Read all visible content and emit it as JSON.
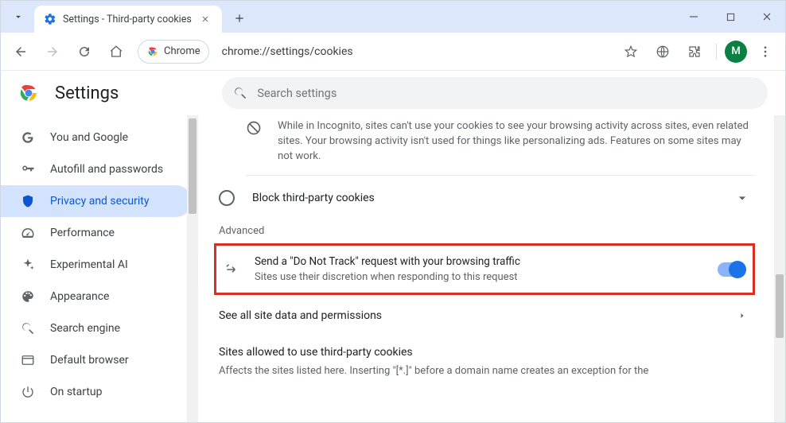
{
  "window": {
    "tab_title": "Settings - Third-party cookies",
    "omni_chip": "Chrome",
    "url": "chrome://settings/cookies",
    "avatar_letter": "M"
  },
  "app": {
    "title": "Settings",
    "search_placeholder": "Search settings"
  },
  "sidebar": {
    "items": [
      {
        "label": "You and Google"
      },
      {
        "label": "Autofill and passwords"
      },
      {
        "label": "Privacy and security"
      },
      {
        "label": "Performance"
      },
      {
        "label": "Experimental AI"
      },
      {
        "label": "Appearance"
      },
      {
        "label": "Search engine"
      },
      {
        "label": "Default browser"
      },
      {
        "label": "On startup"
      }
    ]
  },
  "content": {
    "incognito_info": "While in Incognito, sites can't use your cookies to see your browsing activity across sites, even related sites. Your browsing activity isn't used for things like personalizing ads. Features on some sites may not work.",
    "block_label": "Block third-party cookies",
    "advanced_label": "Advanced",
    "dnt_title": "Send a \"Do Not Track\" request with your browsing traffic",
    "dnt_sub": "Sites use their discretion when responding to this request",
    "see_all": "See all site data and permissions",
    "allowed_heading": "Sites allowed to use third-party cookies",
    "allowed_desc": "Affects the sites listed here. Inserting \"[*.]\" before a domain name creates an exception for the"
  },
  "colors": {
    "accent": "#1a73e8",
    "highlight_border": "#d93025"
  }
}
